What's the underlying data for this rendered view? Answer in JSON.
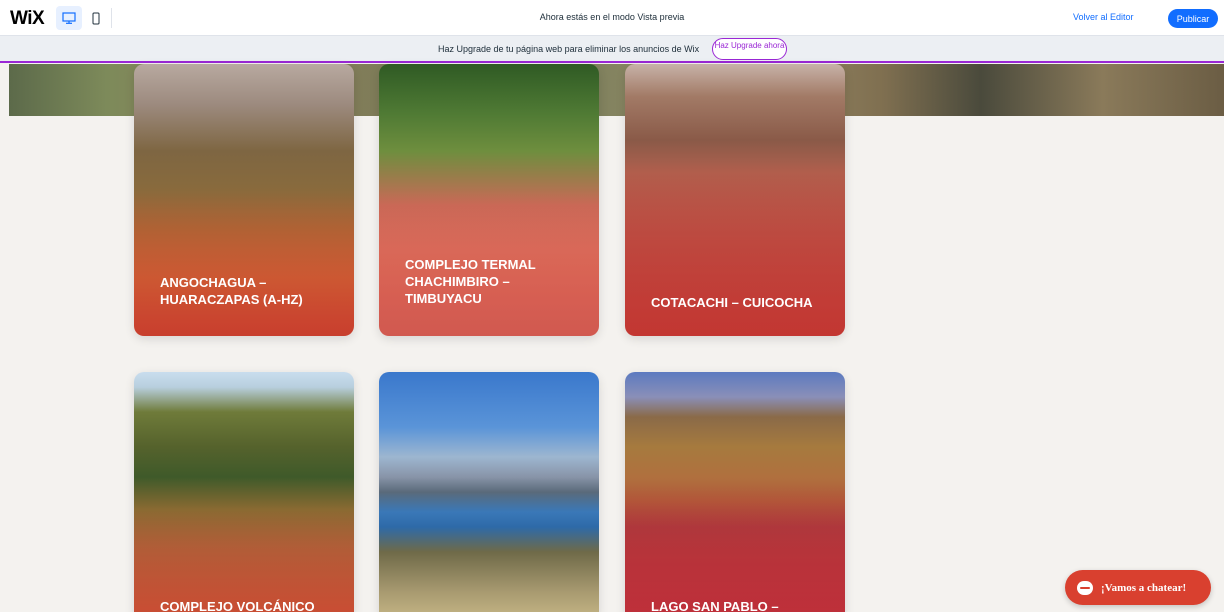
{
  "topbar": {
    "logo": "WiX",
    "preview_message": "Ahora estás en el modo Vista previa",
    "back_to_editor": "Volver al Editor",
    "publish": "Publicar"
  },
  "banner": {
    "text": "Haz Upgrade de tu página web para eliminar los anuncios de Wix",
    "button": "Haz Upgrade ahora"
  },
  "cards": [
    {
      "title": "ANGOCHAGUA – HUARACZAPAS (A-Hz)"
    },
    {
      "title": "COMPLEJO TERMAL CHACHIMBIRO – TIMBUYACU"
    },
    {
      "title": "COTACACHI – CUICOCHA"
    },
    {
      "title": "COMPLEJO VOLCÁNICO"
    },
    {
      "title": ""
    },
    {
      "title": "LAGO SAN PABLO –"
    }
  ],
  "chat": {
    "label": "¡Vamos a chatear!"
  }
}
